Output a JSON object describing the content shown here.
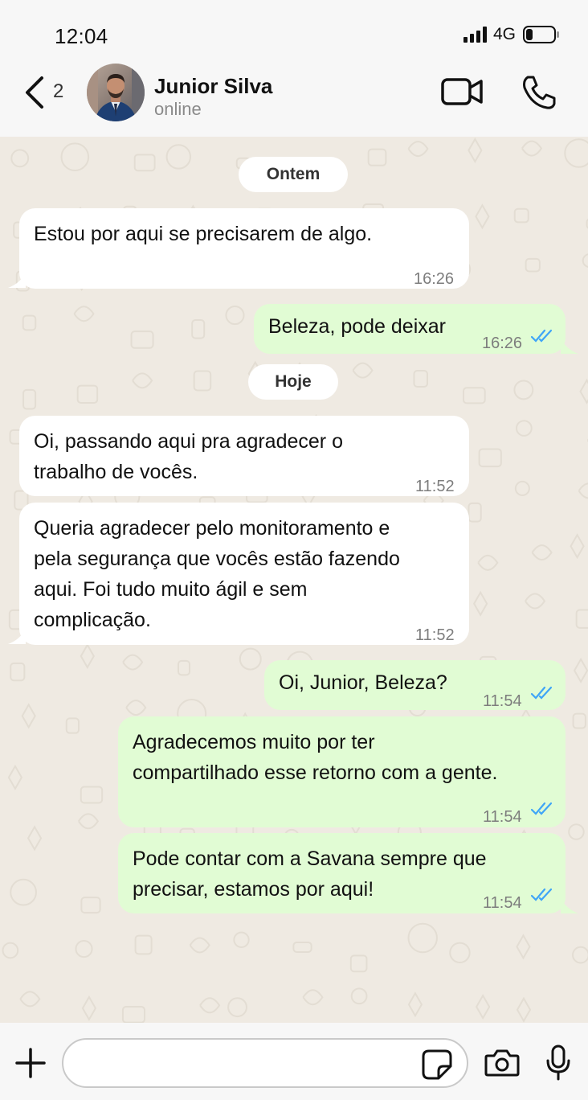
{
  "status_bar": {
    "time": "12:04",
    "network": "4G"
  },
  "header": {
    "back_count": "2",
    "contact_name": "Junior Silva",
    "contact_status": "online"
  },
  "colors": {
    "incoming_bubble": "#ffffff",
    "outgoing_bubble": "#e1fcd4",
    "read_ticks": "#3fa5f7",
    "chat_background": "#efeae2"
  },
  "chat": {
    "dates": [
      "Ontem",
      "Hoje"
    ],
    "messages": [
      {
        "direction": "in",
        "lines": [
          "Estou por aqui se precisarem de algo."
        ],
        "time": "16:26"
      },
      {
        "direction": "out",
        "lines": [
          "Beleza, pode deixar"
        ],
        "time": "16:26",
        "read": true
      },
      {
        "direction": "in",
        "lines": [
          "Oi, passando aqui pra agradecer o",
          "trabalho de vocês."
        ],
        "time": "11:52"
      },
      {
        "direction": "in",
        "lines": [
          "Queria agradecer pelo monitoramento e",
          "pela segurança que vocês estão fazendo",
          "aqui. Foi tudo muito ágil e sem",
          "complicação."
        ],
        "time": "11:52"
      },
      {
        "direction": "out",
        "lines": [
          "Oi, Junior, Beleza?"
        ],
        "time": "11:54",
        "read": true
      },
      {
        "direction": "out",
        "lines": [
          "Agradecemos muito por ter",
          "compartilhado esse retorno com a gente."
        ],
        "time": "11:54",
        "read": true
      },
      {
        "direction": "out",
        "lines": [
          "Pode contar com a Savana sempre que",
          "precisar, estamos por aqui!"
        ],
        "time": "11:54",
        "read": true
      }
    ]
  },
  "input": {
    "placeholder": ""
  },
  "icons": {
    "back": "chevron-left-icon",
    "video": "video-camera-icon",
    "call": "phone-icon",
    "attach": "plus-icon",
    "sticker": "sticker-icon",
    "camera": "camera-icon",
    "mic": "microphone-icon"
  }
}
